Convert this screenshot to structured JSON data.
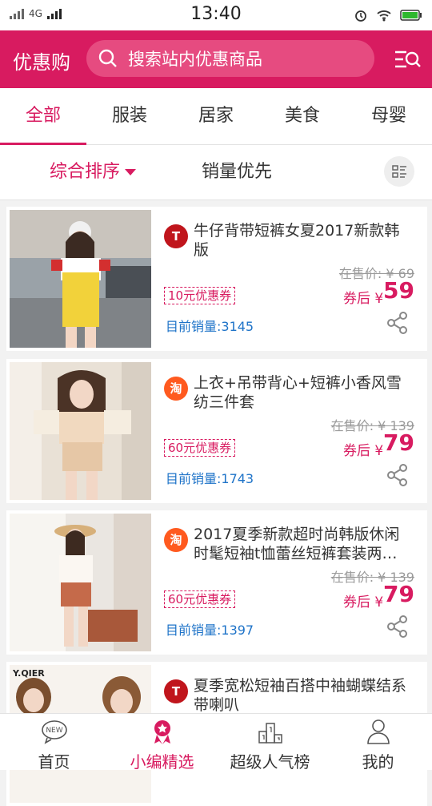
{
  "status_bar": {
    "network": "4G",
    "time": "13:40"
  },
  "header": {
    "logo": "优惠购",
    "search_placeholder": "搜索站内优惠商品"
  },
  "tabs": [
    {
      "label": "全部",
      "active": true
    },
    {
      "label": "服装",
      "active": false
    },
    {
      "label": "居家",
      "active": false
    },
    {
      "label": "美食",
      "active": false
    },
    {
      "label": "母婴",
      "active": false
    }
  ],
  "sort": {
    "comprehensive": "综合排序",
    "sales_first": "销量优先"
  },
  "products": [
    {
      "platform": "T",
      "title": "牛仔背带短裤女夏2017新款韩版",
      "original_price": "在售价: ¥ 69",
      "coupon": "10元优惠券",
      "after_label": "券后 ¥",
      "price": "59",
      "sales": "目前销量:3145"
    },
    {
      "platform": "淘",
      "title": "上衣+吊带背心+短裤小香风雪纺三件套",
      "original_price": "在售价: ¥ 139",
      "coupon": "60元优惠券",
      "after_label": "券后 ¥",
      "price": "79",
      "sales": "目前销量:1743"
    },
    {
      "platform": "淘",
      "title": "2017夏季新款超时尚韩版休闲时髦短袖t恤蕾丝短裤套装两…",
      "original_price": "在售价: ¥ 139",
      "coupon": "60元优惠券",
      "after_label": "券后 ¥",
      "price": "79",
      "sales": "目前销量:1397"
    },
    {
      "platform": "T",
      "title": "夏季宽松短袖百搭中袖蝴蝶结系带喇叭",
      "brand_text": "Y.QIER"
    }
  ],
  "bottom_nav": [
    {
      "label": "首页",
      "icon": "new-badge-icon",
      "badge": "NEW"
    },
    {
      "label": "小编精选",
      "icon": "award-ribbon-icon",
      "active": true
    },
    {
      "label": "超级人气榜",
      "icon": "podium-icon"
    },
    {
      "label": "我的",
      "icon": "user-icon"
    }
  ],
  "colors": {
    "accent": "#d81b60",
    "link": "#1e73c8"
  }
}
